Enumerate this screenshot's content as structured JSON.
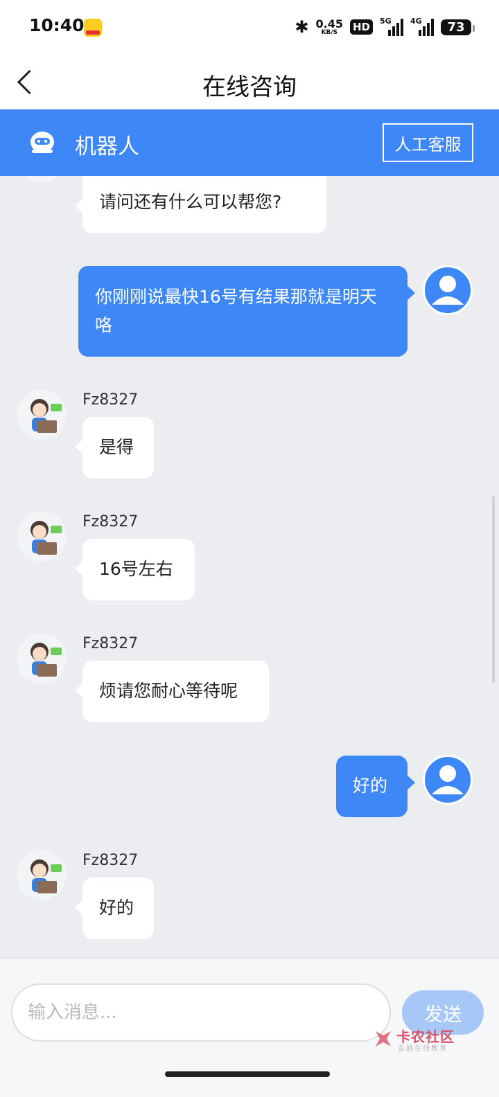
{
  "status_bar": {
    "time": "10:40",
    "app_icon": "meituan-icon",
    "net_speed_value": "0.45",
    "net_speed_unit": "KB/S",
    "hd_label": "HD",
    "signal_1_label": "5G",
    "signal_2_label": "4G",
    "battery": "73"
  },
  "nav": {
    "title": "在线咨询"
  },
  "bot_header": {
    "name": "机器人",
    "human_service_label": "人工客服"
  },
  "messages": [
    {
      "direction": "in",
      "text": "请问还有什么可以帮您?"
    },
    {
      "direction": "out",
      "text": "你刚刚说最快16号有结果那就是明天咯"
    },
    {
      "direction": "in",
      "sender": "Fz8327",
      "text": "是得"
    },
    {
      "direction": "in",
      "sender": "Fz8327",
      "text": "16号左右"
    },
    {
      "direction": "in",
      "sender": "Fz8327",
      "text": "烦请您耐心等待呢"
    },
    {
      "direction": "out",
      "text": "好的"
    },
    {
      "direction": "in",
      "sender": "Fz8327",
      "text": "好的"
    }
  ],
  "input": {
    "placeholder": "输入消息...",
    "value": "",
    "send_label": "发送"
  },
  "watermark": {
    "title": "卡农社区",
    "subtitle": "金融在线教育"
  },
  "colors": {
    "brand_blue": "#3d87f6",
    "send_disabled": "#a7c8f7",
    "chat_background": "#ebedf0"
  }
}
